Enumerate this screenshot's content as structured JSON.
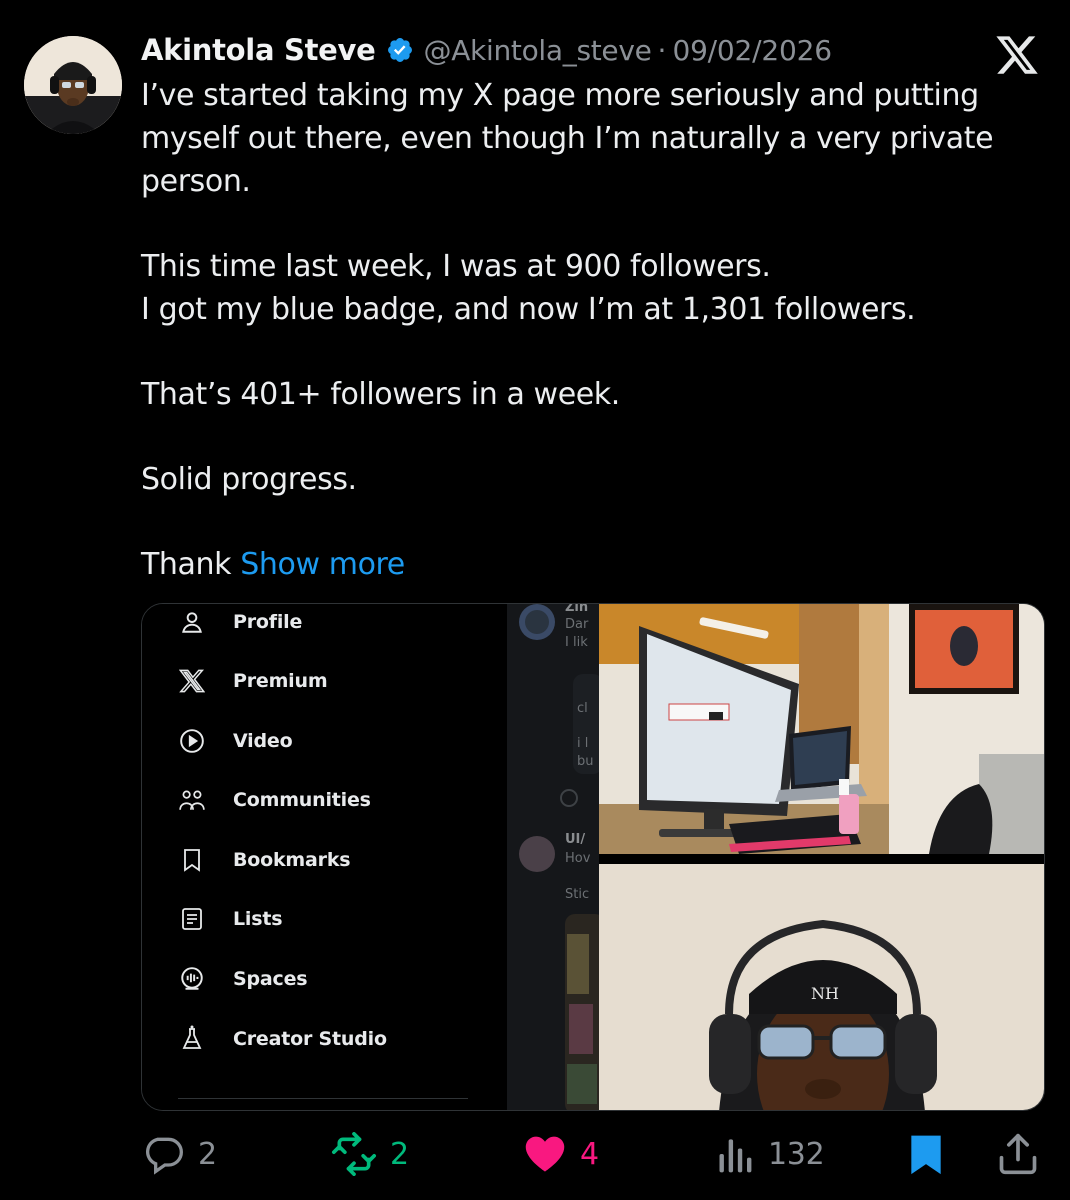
{
  "tweet": {
    "author_name": "Akintola Steve",
    "handle": "@Akintola_steve",
    "separator": "·",
    "date": "09/02/2026",
    "paragraphs": [
      "I’ve started taking my X page more seriously and putting myself out there, even though I’m naturally a very private person.",
      "This time last week, I was at 900 followers.",
      "I got my blue badge, and now I’m at 1,301 followers.",
      "That’s 401+ followers in a week.",
      "Solid progress."
    ],
    "truncated_text": "Thank",
    "show_more": "Show more"
  },
  "media_menu": {
    "items": [
      {
        "label": "Profile",
        "icon": "person-icon"
      },
      {
        "label": "Premium",
        "icon": "x-logo-icon"
      },
      {
        "label": "Video",
        "icon": "play-icon"
      },
      {
        "label": "Communities",
        "icon": "communities-icon"
      },
      {
        "label": "Bookmarks",
        "icon": "bookmark-icon"
      },
      {
        "label": "Lists",
        "icon": "list-icon"
      },
      {
        "label": "Spaces",
        "icon": "spaces-icon"
      },
      {
        "label": "Creator Studio",
        "icon": "flask-icon"
      }
    ]
  },
  "feed_strip": {
    "snippets": [
      "Zin",
      "Dar",
      "I lik",
      "cl",
      "i l",
      "bu",
      "UI/",
      "Hov",
      "Stic"
    ]
  },
  "actions": {
    "replies": "2",
    "reposts": "2",
    "likes": "4",
    "views": "132"
  },
  "colors": {
    "background": "#000000",
    "text": "#e7e9ea",
    "muted": "#8b9096",
    "link": "#1d9bf0",
    "repost": "#00ba7c",
    "like": "#f91880",
    "bookmark_active": "#1d9bf0"
  }
}
